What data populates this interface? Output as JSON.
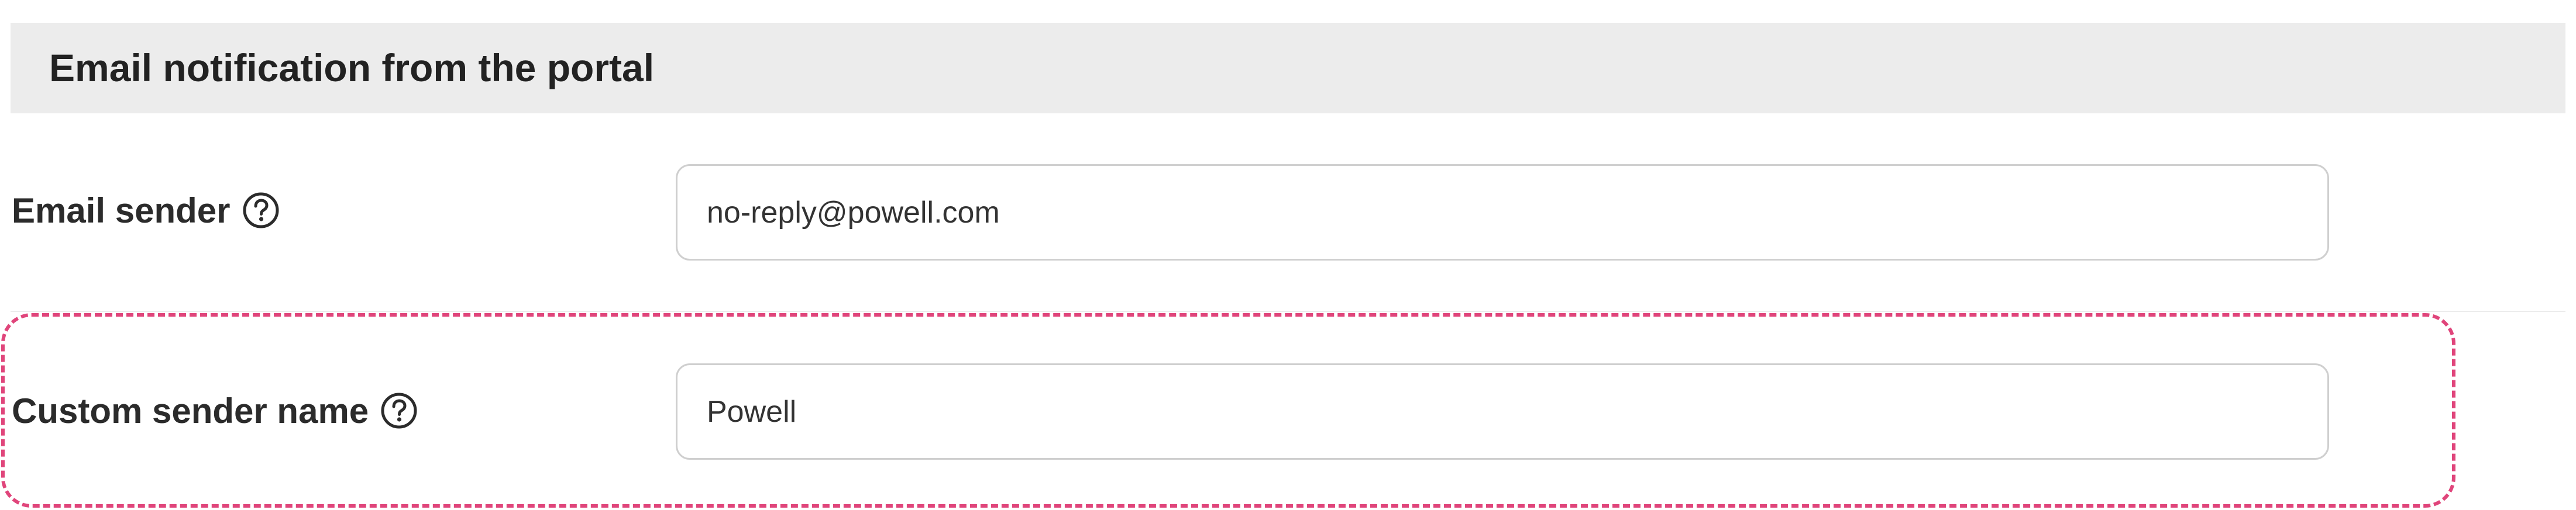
{
  "section": {
    "title": "Email notification from the portal"
  },
  "fields": {
    "email_sender": {
      "label": "Email sender",
      "value": "no-reply@powell.com",
      "help_icon": "question-circle-icon"
    },
    "custom_sender_name": {
      "label": "Custom sender name",
      "value": "Powell",
      "help_icon": "question-circle-icon"
    }
  },
  "colors": {
    "header_background": "#ececec",
    "highlight_border": "#e0457b",
    "input_border": "#cfcfcf",
    "label_text": "#2b2b2b"
  }
}
